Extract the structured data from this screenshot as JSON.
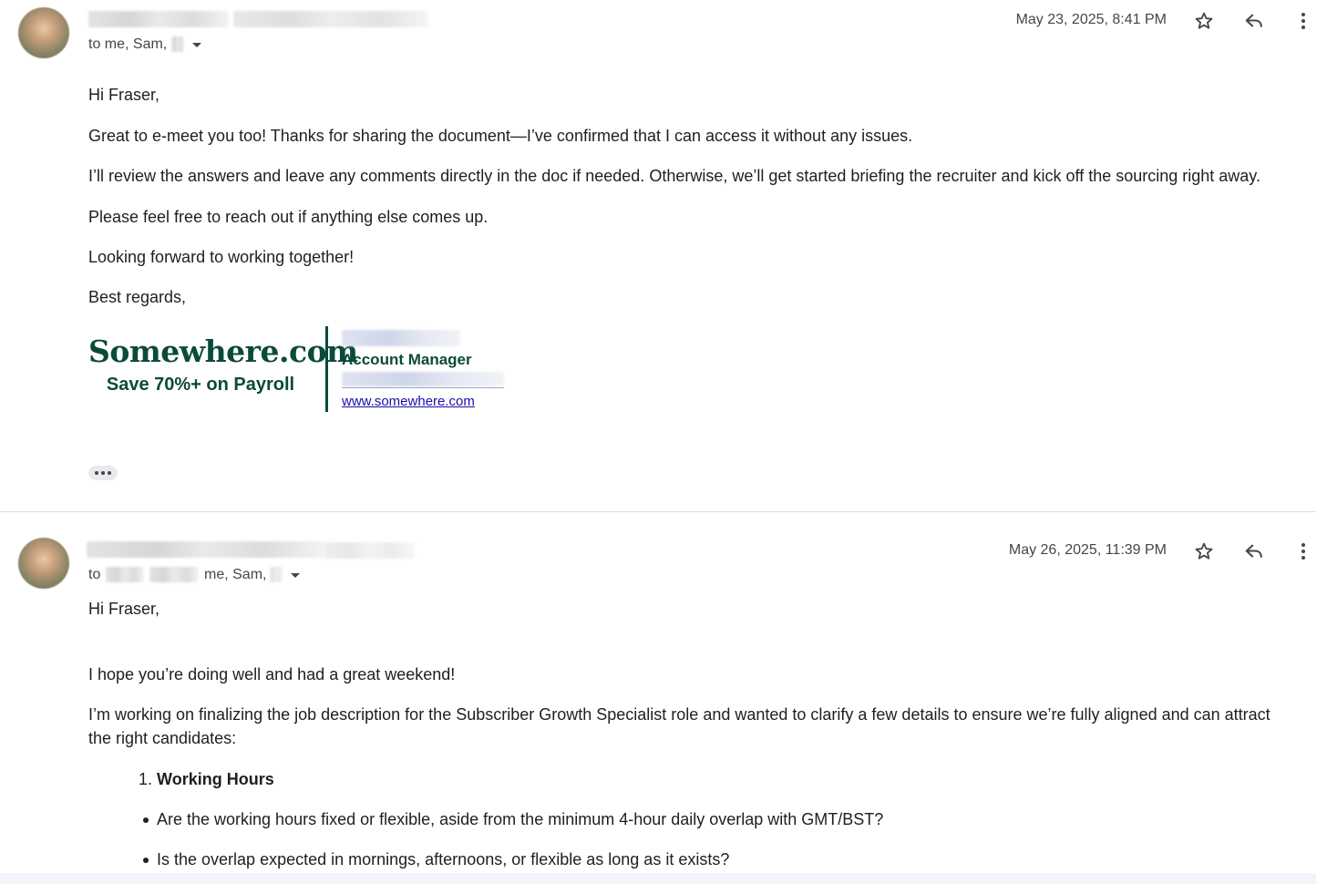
{
  "messages": [
    {
      "recipients_text": "to me, Sam,",
      "date": "May 23, 2025, 8:41 PM",
      "body": {
        "greeting": "Hi Fraser,",
        "paragraphs": [
          "Great to e-meet you too! Thanks for sharing the document—I’ve confirmed that I can access it without any issues.",
          "I’ll review the answers and leave any comments directly in the doc if needed. Otherwise, we’ll get started briefing the recruiter and kick off the sourcing right away.",
          "Please feel free to reach out if anything else comes up.",
          "Looking forward to working together!",
          "Best regards,"
        ]
      },
      "signature": {
        "brand": "Somewhere.com",
        "tagline": "Save 70%+ on Payroll",
        "role": "Account Manager",
        "website": "www.somewhere.com",
        "brand_color": "#0b4a3b"
      }
    },
    {
      "recipients_prefix": "to",
      "recipients_text": "me, Sam,",
      "date": "May 26, 2025, 11:39 PM",
      "body": {
        "greeting": "Hi Fraser,",
        "paragraphs": [
          "I hope you’re doing well and had a great weekend!",
          "I’m working on finalizing the job description for the Subscriber Growth Specialist role and wanted to clarify a few details to ensure we’re fully aligned and can attract the right candidates:"
        ],
        "numbered_item": {
          "number": "1.",
          "title": "Working Hours"
        },
        "bullets": [
          "Are the working hours fixed or flexible, aside from the minimum 4-hour daily overlap with GMT/BST?",
          "Is the overlap expected in mornings, afternoons, or flexible as long as it exists?"
        ]
      }
    }
  ],
  "icons": [
    "star-icon",
    "reply-icon",
    "more-vert-icon",
    "caret-down-icon"
  ]
}
